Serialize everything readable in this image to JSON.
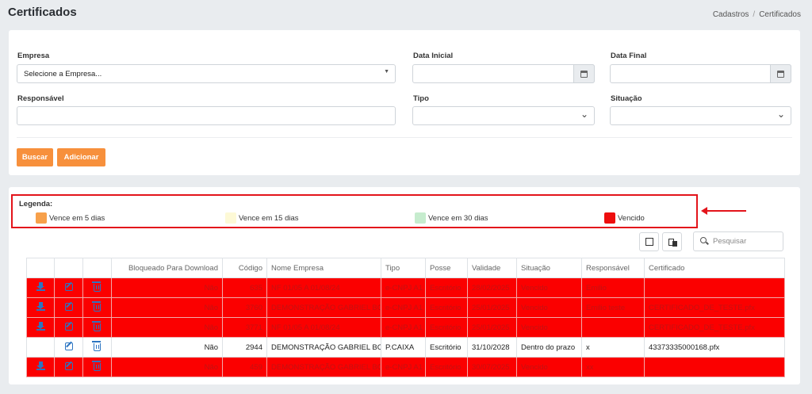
{
  "header": {
    "title": "Certificados",
    "breadcrumb": [
      "Cadastros",
      "Certificados"
    ]
  },
  "filters": {
    "empresa_label": "Empresa",
    "empresa_value": "Selecione a Empresa...",
    "data_inicial_label": "Data Inicial",
    "data_final_label": "Data Final",
    "responsavel_label": "Responsável",
    "tipo_label": "Tipo",
    "situacao_label": "Situação",
    "buscar_label": "Buscar",
    "adicionar_label": "Adicionar"
  },
  "legend": {
    "title": "Legenda:",
    "items": [
      {
        "label": "Vence em 5 dias",
        "color": "#f7a04a"
      },
      {
        "label": "Vence em 15 dias",
        "color": "#fdf9d6"
      },
      {
        "label": "Vence em 30 dias",
        "color": "#c6ecce"
      },
      {
        "label": "Vencido",
        "color": "#ee0e0e"
      }
    ]
  },
  "toolbar": {
    "search_placeholder": "Pesquisar",
    "icons": [
      "export-icon",
      "columns-icon",
      "search-icon"
    ]
  },
  "table": {
    "headers": [
      "",
      "",
      "",
      "Bloqueado Para Download",
      "Código",
      "Nome Empresa",
      "Tipo",
      "Posse",
      "Validade",
      "Situação",
      "Responsável",
      "Certificado"
    ],
    "rows": [
      {
        "status": "vencido",
        "bloqueado": "Não",
        "codigo": "635",
        "empresa": "NF 01/05 A 01/08/24",
        "tipo": "e-CNPJ A1",
        "posse": "Escritório",
        "validade": "28/02/2025",
        "situacao": "Vencido",
        "responsavel": "Emilio",
        "certificado": ""
      },
      {
        "status": "vencido",
        "bloqueado": "Não",
        "codigo": "3760",
        "empresa": "DEMONSTRAÇÃO GABRIEL BOT",
        "tipo": "e-CNPJ A1",
        "posse": "Escritório",
        "validade": "25/01/2025",
        "situacao": "Vencido",
        "responsavel": "Emilio teste",
        "certificado": "CERTIFICADO_DE_TESTE.pfx"
      },
      {
        "status": "vencido",
        "bloqueado": "Não",
        "codigo": "3771",
        "empresa": "NF 01/05 A 01/08/24",
        "tipo": "e-CNPJ A1",
        "posse": "Escritório",
        "validade": "25/01/2025",
        "situacao": "Vencido",
        "responsavel": "",
        "certificado": "CERTIFICADO_DE_TESTE.pfx"
      },
      {
        "status": "normal",
        "bloqueado": "Não",
        "codigo": "2944",
        "empresa": "DEMONSTRAÇÃO GABRIEL BOT",
        "tipo": "P.CAIXA",
        "posse": "Escritório",
        "validade": "31/10/2028",
        "situacao": "Dentro do prazo",
        "responsavel": "x",
        "certificado": "43373335000168.pfx"
      },
      {
        "status": "vencido",
        "bloqueado": "Não",
        "codigo": "459",
        "empresa": "DEMONSTRAÇÃO GABRIEL BOT",
        "tipo": "e-CNPJ A1",
        "posse": "Escritório",
        "validade": "30/07/2025",
        "situacao": "Vencido",
        "responsavel": "xx",
        "certificado": ""
      }
    ]
  }
}
